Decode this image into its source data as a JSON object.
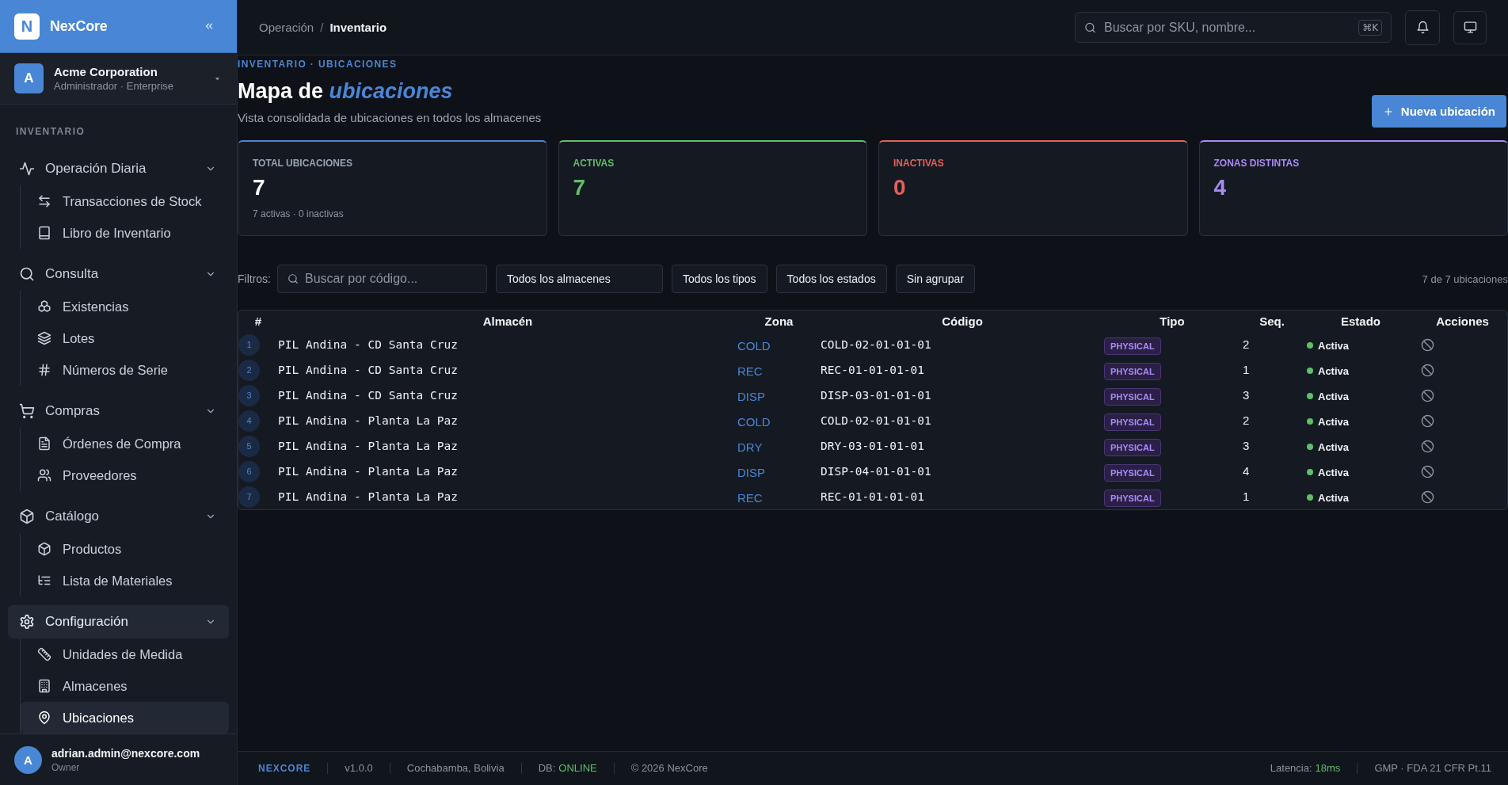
{
  "sidebar": {
    "brand": {
      "logo_letter": "N",
      "name": "NexCore"
    },
    "organization": {
      "avatar_letter": "A",
      "name": "Acme Corporation",
      "subtitle": "Administrador · Enterprise"
    },
    "section_title": "INVENTARIO",
    "groups": [
      {
        "label": "Operación Diaria",
        "expanded": true,
        "selected": false,
        "children": [
          {
            "label": "Transacciones de Stock",
            "selected": false
          },
          {
            "label": "Libro de Inventario",
            "selected": false
          }
        ]
      },
      {
        "label": "Consulta",
        "expanded": true,
        "selected": false,
        "children": [
          {
            "label": "Existencias",
            "selected": false
          },
          {
            "label": "Lotes",
            "selected": false
          },
          {
            "label": "Números de Serie",
            "selected": false
          }
        ]
      },
      {
        "label": "Compras",
        "expanded": true,
        "selected": false,
        "children": [
          {
            "label": "Órdenes de Compra",
            "selected": false
          },
          {
            "label": "Proveedores",
            "selected": false
          }
        ]
      },
      {
        "label": "Catálogo",
        "expanded": true,
        "selected": false,
        "children": [
          {
            "label": "Productos",
            "selected": false
          },
          {
            "label": "Lista de Materiales",
            "selected": false
          }
        ]
      },
      {
        "label": "Configuración",
        "expanded": true,
        "selected": true,
        "children": [
          {
            "label": "Unidades de Medida",
            "selected": false
          },
          {
            "label": "Almacenes",
            "selected": false
          },
          {
            "label": "Ubicaciones",
            "selected": true
          }
        ]
      }
    ],
    "user": {
      "avatar_letter": "A",
      "email": "adrian.admin@nexcore.com",
      "role": "Owner"
    }
  },
  "topbar": {
    "breadcrumb": {
      "separator": "/",
      "items": [
        {
          "label": "Operación",
          "selected": false
        },
        {
          "label": "Inventario",
          "selected": true
        }
      ]
    },
    "search": {
      "placeholder": "Buscar por SKU, nombre...",
      "shortcut": "⌘K"
    }
  },
  "page_header": {
    "eyebrow": "INVENTARIO · UBICACIONES",
    "title": "Mapa de *ubicaciones*",
    "subtitle": "Vista consolidada de ubicaciones en todos los almacenes",
    "primary_button": "Nueva ubicación"
  },
  "stats": [
    {
      "kind": "total",
      "label": "TOTAL UBICACIONES",
      "value": "7",
      "note": "7 activas · 0 inactivas",
      "color": "#4a86d6"
    },
    {
      "kind": "metric",
      "label": "ACTIVAS",
      "value": "7",
      "color": "#5fbf6a"
    },
    {
      "kind": "metric",
      "label": "INACTIVAS",
      "value": "0",
      "color": "#e5605a"
    },
    {
      "kind": "metric",
      "label": "ZONAS DISTINTAS",
      "value": "4",
      "color": "#a98bf5"
    }
  ],
  "filters": {
    "label": "Filtros:",
    "search": {
      "placeholder": "Buscar por código..."
    },
    "dropdowns": [
      "Todos los almacenes",
      "Todos los tipos",
      "Todos los estados",
      "Sin agrupar"
    ],
    "count": "7 de 7 ubicaciones"
  },
  "table": {
    "columns": [
      "#",
      "Almacén",
      "Zona",
      "Código",
      "Tipo",
      "Seq.",
      "Estado",
      "Acciones"
    ],
    "rows": [
      {
        "index": "1",
        "warehouse": "PIL Andina - CD Santa Cruz",
        "zone": "COLD",
        "code": "COLD-02-01-01-01",
        "type": "PHYSICAL",
        "seq": "2",
        "status": "Activa",
        "active": true
      },
      {
        "index": "2",
        "warehouse": "PIL Andina - CD Santa Cruz",
        "zone": "REC",
        "code": "REC-01-01-01-01",
        "type": "PHYSICAL",
        "seq": "1",
        "status": "Activa",
        "active": true
      },
      {
        "index": "3",
        "warehouse": "PIL Andina - CD Santa Cruz",
        "zone": "DISP",
        "code": "DISP-03-01-01-01",
        "type": "PHYSICAL",
        "seq": "3",
        "status": "Activa",
        "active": true
      },
      {
        "index": "4",
        "warehouse": "PIL Andina - Planta La Paz",
        "zone": "COLD",
        "code": "COLD-02-01-01-01",
        "type": "PHYSICAL",
        "seq": "2",
        "status": "Activa",
        "active": true
      },
      {
        "index": "5",
        "warehouse": "PIL Andina - Planta La Paz",
        "zone": "DRY",
        "code": "DRY-03-01-01-01",
        "type": "PHYSICAL",
        "seq": "3",
        "status": "Activa",
        "active": true
      },
      {
        "index": "6",
        "warehouse": "PIL Andina - Planta La Paz",
        "zone": "DISP",
        "code": "DISP-04-01-01-01",
        "type": "PHYSICAL",
        "seq": "4",
        "status": "Activa",
        "active": true
      },
      {
        "index": "7",
        "warehouse": "PIL Andina - Planta La Paz",
        "zone": "REC",
        "code": "REC-01-01-01-01",
        "type": "PHYSICAL",
        "seq": "1",
        "status": "Activa",
        "active": true
      }
    ]
  },
  "status_bar": {
    "brand": "NEXCORE",
    "left": [
      {
        "kind": "text",
        "text": "v1.0.0"
      },
      {
        "kind": "text",
        "text": "Cochabamba, Bolivia"
      },
      {
        "kind": "metric",
        "label": "DB:",
        "value": "ONLINE"
      },
      {
        "kind": "text",
        "text": "© 2026 NexCore"
      }
    ],
    "right": [
      {
        "kind": "metric",
        "label": "Latencia:",
        "value": "18ms"
      },
      {
        "kind": "text",
        "text": "GMP · FDA 21 CFR Pt.11"
      }
    ]
  }
}
